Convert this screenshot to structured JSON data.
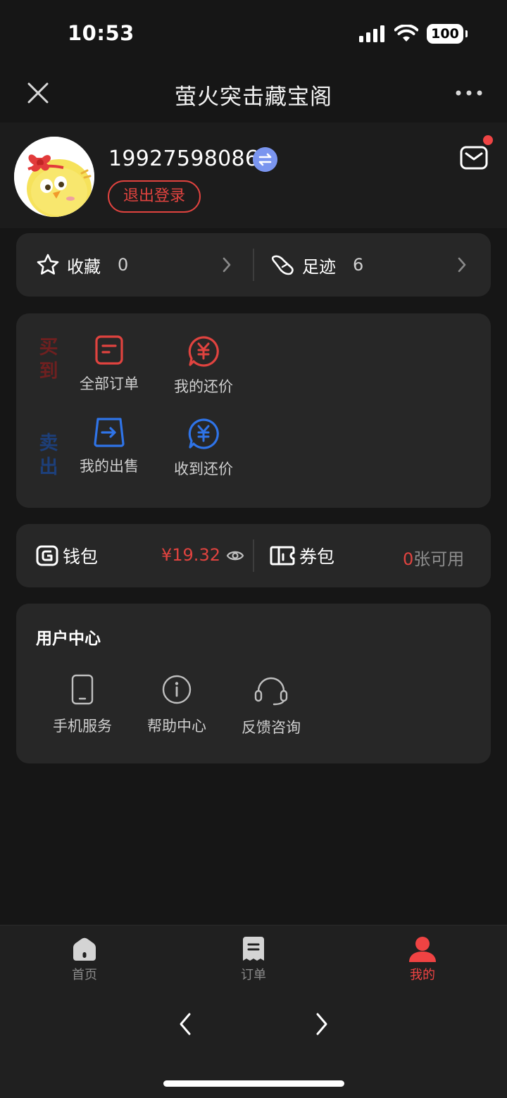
{
  "status_bar": {
    "time": "10:53",
    "battery": "100"
  },
  "nav": {
    "title": "萤火突击藏宝阁"
  },
  "profile": {
    "phone": "19927598086",
    "logout_label": "退出登录",
    "has_unread_mail": true
  },
  "favorites": {
    "label": "收藏",
    "count": "0"
  },
  "footprints": {
    "label": "足迹",
    "count": "6"
  },
  "trade": {
    "buy_label": "买到",
    "sell_label": "卖出",
    "buy_items": [
      {
        "label": "全部订单",
        "icon": "order-icon"
      },
      {
        "label": "我的还价",
        "icon": "yuan-bubble-icon"
      }
    ],
    "sell_items": [
      {
        "label": "我的出售",
        "icon": "sell-export-icon"
      },
      {
        "label": "收到还价",
        "icon": "yuan-bubble-icon"
      }
    ],
    "buy_color": "#e0433f",
    "sell_color": "#2f74e8"
  },
  "wallet": {
    "label": "钱包",
    "amount": "¥19.32",
    "coupon_label": "券包",
    "coupon_count": "0",
    "coupon_suffix": "张可用"
  },
  "user_center": {
    "title": "用户中心",
    "items": [
      {
        "label": "手机服务",
        "icon": "phone-icon"
      },
      {
        "label": "帮助中心",
        "icon": "info-icon"
      },
      {
        "label": "反馈咨询",
        "icon": "headset-icon"
      }
    ]
  },
  "tabs": [
    {
      "label": "首页",
      "icon": "home-icon",
      "active": false
    },
    {
      "label": "订单",
      "icon": "order-tab-icon",
      "active": false
    },
    {
      "label": "我的",
      "icon": "profile-icon",
      "active": true
    }
  ],
  "colors": {
    "accent": "#e0433f",
    "sell_blue": "#2f74e8",
    "card_bg": "#272727",
    "page_bg": "#161616"
  }
}
